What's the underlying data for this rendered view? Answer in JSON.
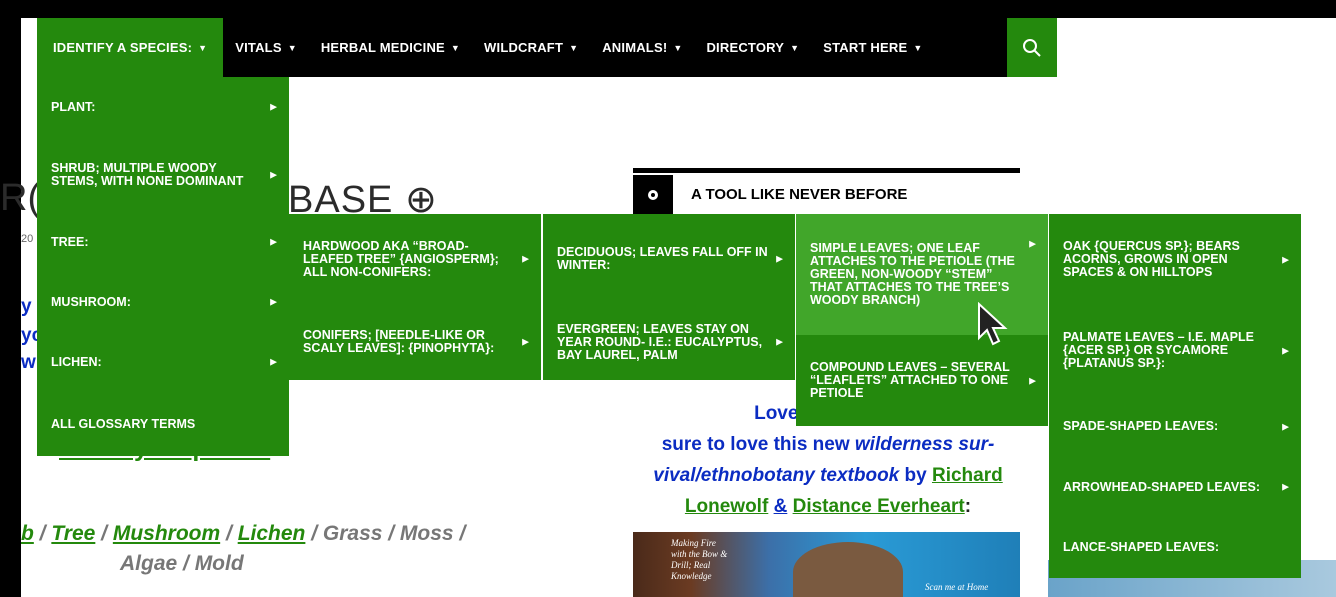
{
  "nav": {
    "items": [
      {
        "label": "IDENTIFY A SPECIES:",
        "active": true
      },
      {
        "label": "VITALS"
      },
      {
        "label": "HERBAL MEDICINE"
      },
      {
        "label": "WILDCRAFT"
      },
      {
        "label": "ANIMALS!"
      },
      {
        "label": "DIRECTORY"
      },
      {
        "label": "START HERE"
      }
    ],
    "caret": "▼",
    "search_icon": "search-icon"
  },
  "menu1": {
    "items": [
      "PLANT:",
      "SHRUB; MULTIPLE WOODY STEMS, WITH NONE DOMINANT",
      "TREE:",
      "MUSHROOM:",
      "LICHEN:",
      "ALL GLOSSARY TERMS"
    ]
  },
  "menu2": {
    "items": [
      "HARDWOOD AKA “BROAD-LEAFED TREE” {ANGIOSPERM}; ALL NON-CONIFERS:",
      "CONIFERS; [NEEDLE-LIKE OR SCALY LEAVES]: {PINOPHYTA}:"
    ]
  },
  "menu3": {
    "items": [
      "DECIDUOUS; LEAVES FALL OFF IN WINTER:",
      "EVERGREEN; LEAVES STAY ON YEAR ROUND- I.E.: EUCALYPTUS, BAY LAUREL, PALM"
    ]
  },
  "menu4": {
    "items": [
      "SIMPLE LEAVES; ONE LEAF ATTACHES TO THE PETIOLE (THE GREEN, NON-WOODY “STEM” THAT ATTACHES TO THE TREE’S WOODY BRANCH)",
      "COMPOUND LEAVES – SEVERAL “LEAFLETS” ATTACHED TO ONE PETIOLE"
    ]
  },
  "menu5": {
    "items": [
      "OAK {QUERCUS SP.}; BEARS ACORNS, GROWS IN OPEN SPACES & ON HILLTOPS",
      "PALMATE LEAVES – I.E. MAPLE {ACER SP.} OR SYCAMORE {PLATANUS SP.}:",
      "SPADE-SHAPED LEAVES:",
      "ARROWHEAD-SHAPED LEAVES:",
      "LANCE-SHAPED LEAVES:"
    ]
  },
  "arrow": "▶",
  "content": {
    "heading_left": "R(",
    "heading_right": "BASE ⊕",
    "date_frag": "20",
    "blue_frags": [
      "y",
      "yc",
      "w"
    ],
    "tool_title": "A TOOL LIKE NEVER BEFORE",
    "identify_link": "Identify a Species",
    "species_line": {
      "b": "b",
      "sep1": " / ",
      "tree": "Tree",
      "sep2": " / ",
      "mushroom": "Mushroom",
      "sep3": " / ",
      "lichen": "Lichen",
      "rest": " / Grass / Moss /"
    },
    "species_line2": "Algae / Mold",
    "promo": {
      "line1": "Love what you s",
      "line2a": "sure to love this new ",
      "line2b": "wilderness sur-",
      "line3a": "vival/ethnobotany textbook",
      "line3b": " by ",
      "author1": "Richard",
      "author1b": "Lonewolf",
      "amp": "&",
      "author2": "Distance Everheart",
      "colon": ":"
    },
    "book_text": "Making Fire with the Bow & Drill; Real Knowledge",
    "book_text2": "Scan me at Home"
  },
  "colors": {
    "green": "#24890d",
    "green_hl": "#41a62a",
    "blue": "#0b2cc2"
  }
}
